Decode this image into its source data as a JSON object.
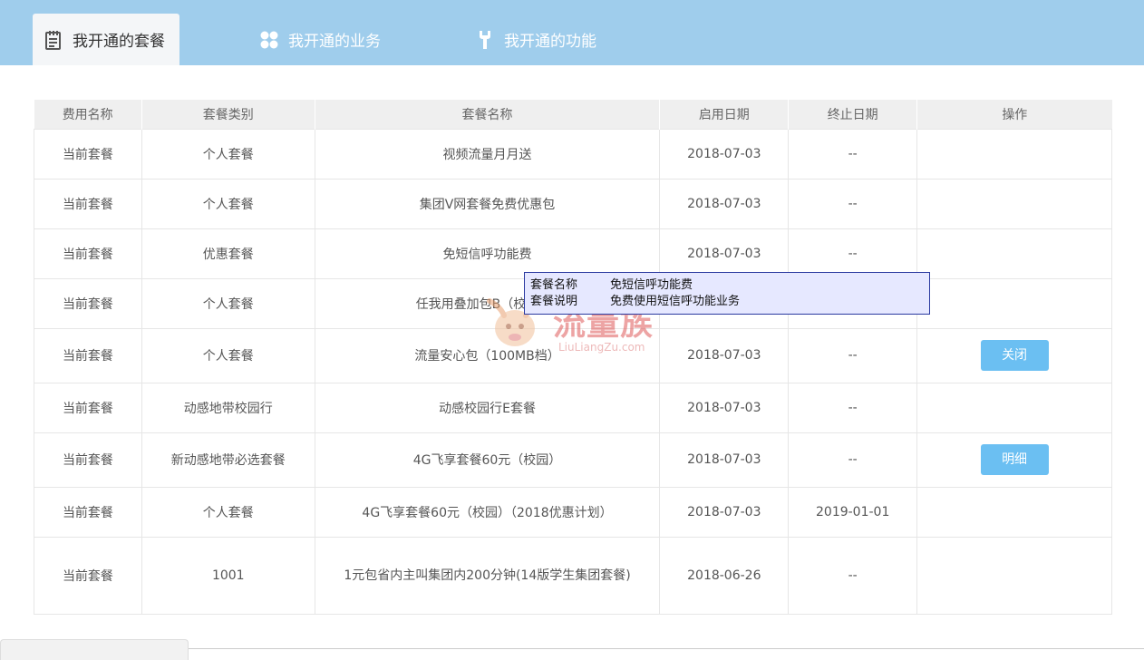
{
  "tabs": [
    {
      "label": "我开通的套餐",
      "icon": "notepad-icon"
    },
    {
      "label": "我开通的业务",
      "icon": "grid-icon"
    },
    {
      "label": "我开通的功能",
      "icon": "wrench-icon"
    }
  ],
  "table": {
    "headers": [
      "费用名称",
      "套餐类别",
      "套餐名称",
      "启用日期",
      "终止日期",
      "操作"
    ],
    "rows": [
      {
        "fee": "当前套餐",
        "category": "个人套餐",
        "name": "视频流量月月送",
        "start": "2018-07-03",
        "end": "--",
        "action": ""
      },
      {
        "fee": "当前套餐",
        "category": "个人套餐",
        "name": "集团V网套餐免费优惠包",
        "start": "2018-07-03",
        "end": "--",
        "action": ""
      },
      {
        "fee": "当前套餐",
        "category": "优惠套餐",
        "name": "免短信呼功能费",
        "start": "2018-07-03",
        "end": "--",
        "action": ""
      },
      {
        "fee": "当前套餐",
        "category": "个人套餐",
        "name": "任我用叠加包B（校",
        "start": "",
        "end": "",
        "action": ""
      },
      {
        "fee": "当前套餐",
        "category": "个人套餐",
        "name": "流量安心包（100MB档）",
        "start": "2018-07-03",
        "end": "--",
        "action": "关闭"
      },
      {
        "fee": "当前套餐",
        "category": "动感地带校园行",
        "name": "动感校园行E套餐",
        "start": "2018-07-03",
        "end": "--",
        "action": ""
      },
      {
        "fee": "当前套餐",
        "category": "新动感地带必选套餐",
        "name": "4G飞享套餐60元（校园）",
        "start": "2018-07-03",
        "end": "--",
        "action": "明细"
      },
      {
        "fee": "当前套餐",
        "category": "个人套餐",
        "name": "4G飞享套餐60元（校园）（2018优惠计划）",
        "start": "2018-07-03",
        "end": "2019-01-01",
        "action": ""
      },
      {
        "fee": "当前套餐",
        "category": "1001",
        "name": "1元包省内主叫集团内200分钟(14版学生集团套餐)",
        "start": "2018-06-26",
        "end": "--",
        "action": ""
      }
    ]
  },
  "tooltip": {
    "name_label": "套餐名称",
    "name_value": "免短信呼功能费",
    "desc_label": "套餐说明",
    "desc_value": "免费使用短信呼功能业务"
  },
  "watermark": {
    "text": "流量族",
    "sub": "LiuLiangZu.com"
  }
}
